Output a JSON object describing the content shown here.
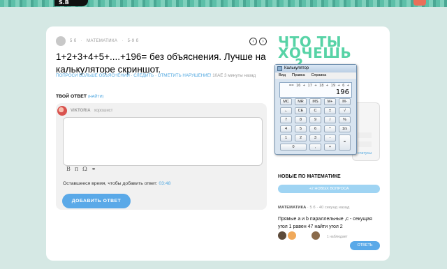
{
  "question": {
    "points": "5 б",
    "subject": "МАТЕМАТИКА",
    "grade": "5-9 б",
    "title": "1+2+3+4+5+....+196= без объяснения. Лучше на калькуляторе скриншот.",
    "action_more": "ПОПРОСИ БОЛЬШЕ ОБЪЯСНЕНИЙ",
    "action_follow": "СЛЕДИТЬ",
    "action_report": "ОТМЕТИТЬ НАРУШЕНИЕ!",
    "asked_ago": "10AE 3 минуты назад",
    "prev_icon": "‹",
    "next_icon": "›"
  },
  "answer_form": {
    "label": "ТВОЙ ОТВЕТ",
    "hint": "(НАЙТИ)",
    "user_name": "VIKTORIA",
    "user_rank": "хорошист",
    "format_bold": "B",
    "format_pi": "π",
    "format_omega": "Ω",
    "format_link": "⚭",
    "time_label": "Оставшееся время, чтобы добавить ответ:",
    "time_value": "03:48",
    "submit_label": "ДОБАВИТЬ ОТВЕТ"
  },
  "sidebar": {
    "promo_line1": "ЧТО ТЫ",
    "promo_line2": "ХОЧЕШЬ",
    "promo_line3": "...?",
    "promo_link": "статусы",
    "new_title": "НОВЫЕ ПО МАТЕМАТИКЕ",
    "new_button": "+2 НОВЫХ ВОПРОСА",
    "item_subject": "МАТЕМАТИКА",
    "item_meta": "· 5 б · 40 секунд назад",
    "item_text": "Прямые a и b параллельные ,c - секущая угол 1 равен 47 найти угол 2",
    "observers": "1 наблюдает",
    "answer_button": "ОТВЕТЬ"
  },
  "calculator": {
    "title": "Калькулятор",
    "menu": [
      "Вид",
      "Правка",
      "Справка"
    ],
    "expression": "== 16 + 17 + 18 + 19 + 6 +",
    "result": "196",
    "keys": [
      "MC",
      "MR",
      "MS",
      "M+",
      "M-",
      "←",
      "CE",
      "C",
      "±",
      "√",
      "7",
      "8",
      "9",
      "/",
      "%",
      "4",
      "5",
      "6",
      "*",
      "1/x",
      "1",
      "2",
      "3",
      "-",
      "=",
      "0",
      ",",
      "+"
    ]
  },
  "colors": {
    "accent_blue": "#5aa9e8",
    "link_blue": "#4fa7e0",
    "promo_green": "#57d3a6",
    "background": "#d5e8e4"
  }
}
